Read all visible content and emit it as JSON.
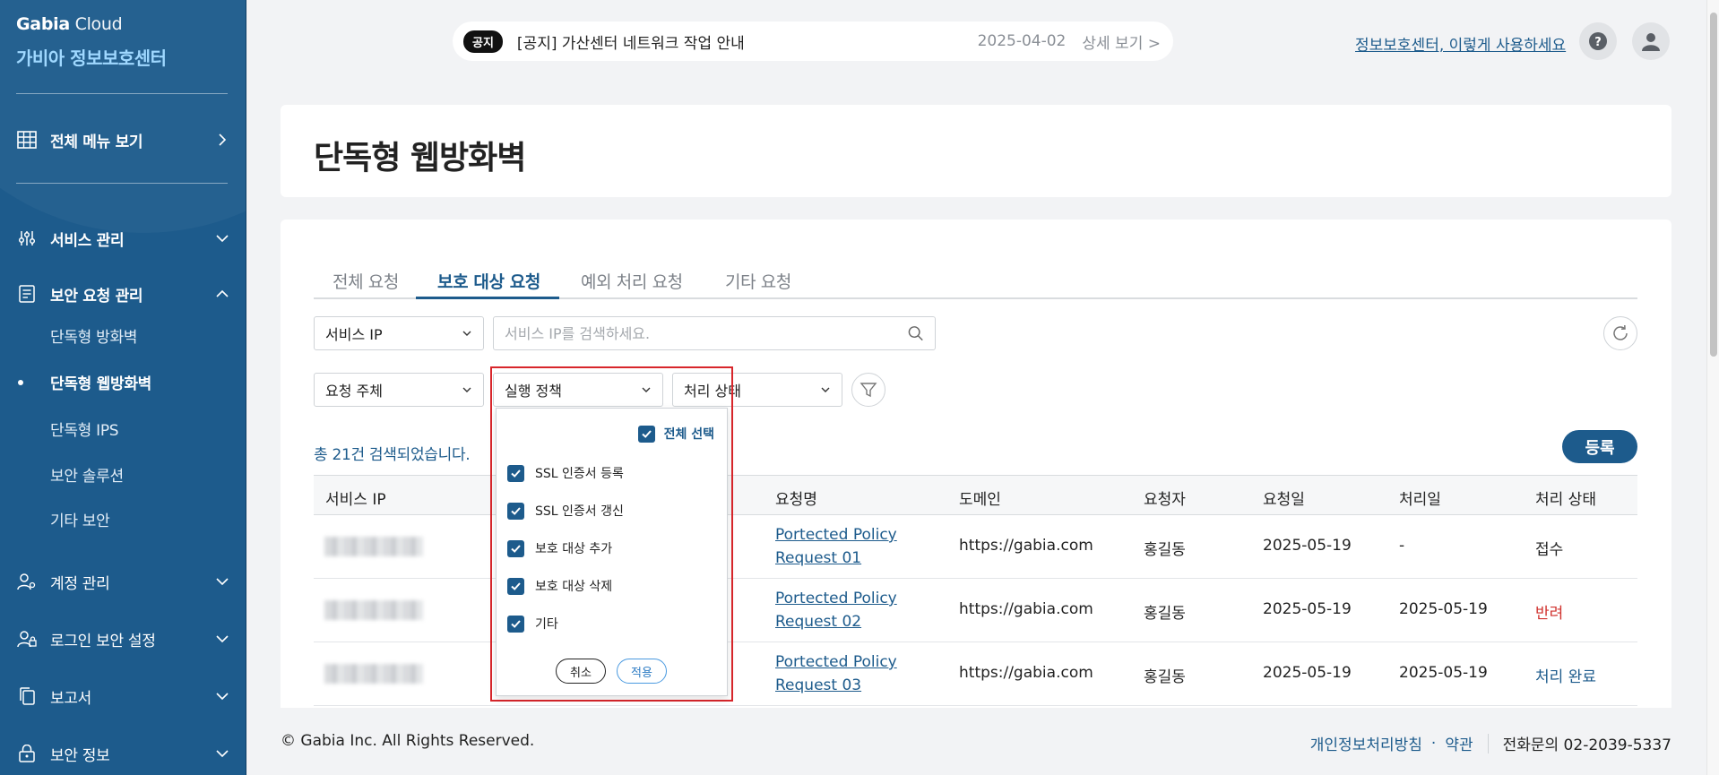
{
  "colors": {
    "primary": "#1d5b8c",
    "accent_light": "#9fd8ff",
    "danger": "#d0312d",
    "highlight": "#d8262b"
  },
  "sidebar": {
    "brand_strong": "Gabia",
    "brand_light": " Cloud",
    "brand_sub": "가비아 정보보호센터",
    "all_menu": "전체 메뉴 보기",
    "groups": [
      {
        "label": "서비스 관리",
        "icon": "sliders-icon"
      },
      {
        "label": "보안 요청 관리",
        "icon": "document-icon"
      },
      {
        "label": "계정 관리",
        "icon": "user-gear-icon"
      },
      {
        "label": "로그인 보안 설정",
        "icon": "user-lock-icon"
      },
      {
        "label": "보고서",
        "icon": "copy-icon"
      },
      {
        "label": "보안 정보",
        "icon": "lock-icon"
      }
    ],
    "subitems": [
      "단독형 방화벽",
      "단독형 웹방화벽",
      "단독형 IPS",
      "보안 솔루션",
      "기타 보안"
    ]
  },
  "header": {
    "notice_tag": "공지",
    "notice_text": "[공지] 가산센터 네트워크 작업 안내",
    "notice_date": "2025-04-02",
    "notice_more": "상세 보기 >",
    "help_link": "정보보호센터, 이렇게 사용하세요"
  },
  "page": {
    "title": "단독형 웹방화벽"
  },
  "tabs": [
    "전체 요청",
    "보호 대상 요청",
    "예외 처리 요청",
    "기타 요청"
  ],
  "filters": {
    "service_ip": "서비스 IP",
    "search_placeholder": "서비스 IP를 검색하세요.",
    "requester": "요청 주체",
    "policy": "실행 정책",
    "status": "처리 상태"
  },
  "result_count": "총 21건 검색되었습니다.",
  "register_label": "등록",
  "table": {
    "columns": [
      "서비스 IP",
      "요청명",
      "도메인",
      "요청자",
      "요청일",
      "처리일",
      "처리 상태"
    ],
    "rows": [
      {
        "name_1": "Portected Policy",
        "name_2": "Request 01",
        "domain": "https://gabia.com",
        "requester": "홍길동",
        "requested": "2025-05-19",
        "processed": "-",
        "status": "접수"
      },
      {
        "name_1": "Portected Policy",
        "name_2": "Request 02",
        "domain": "https://gabia.com",
        "requester": "홍길동",
        "requested": "2025-05-19",
        "processed": "2025-05-19",
        "status": "반려"
      },
      {
        "name_1": "Portected Policy",
        "name_2": "Request 03",
        "domain": "https://gabia.com",
        "requester": "홍길동",
        "requested": "2025-05-19",
        "processed": "2025-05-19",
        "status": "처리 완료"
      }
    ]
  },
  "dropdown": {
    "select_all": "전체 선택",
    "options": [
      "SSL 인증서 등록",
      "SSL 인증서 갱신",
      "보호 대상 추가",
      "보호 대상 삭제",
      "기타"
    ],
    "cancel": "취소",
    "apply": "적용"
  },
  "footer": {
    "copyright": "© Gabia Inc. All Rights Reserved.",
    "privacy": "개인정보처리방침",
    "dot": "·",
    "terms": "약관",
    "phone": "전화문의 02-2039-5337"
  }
}
